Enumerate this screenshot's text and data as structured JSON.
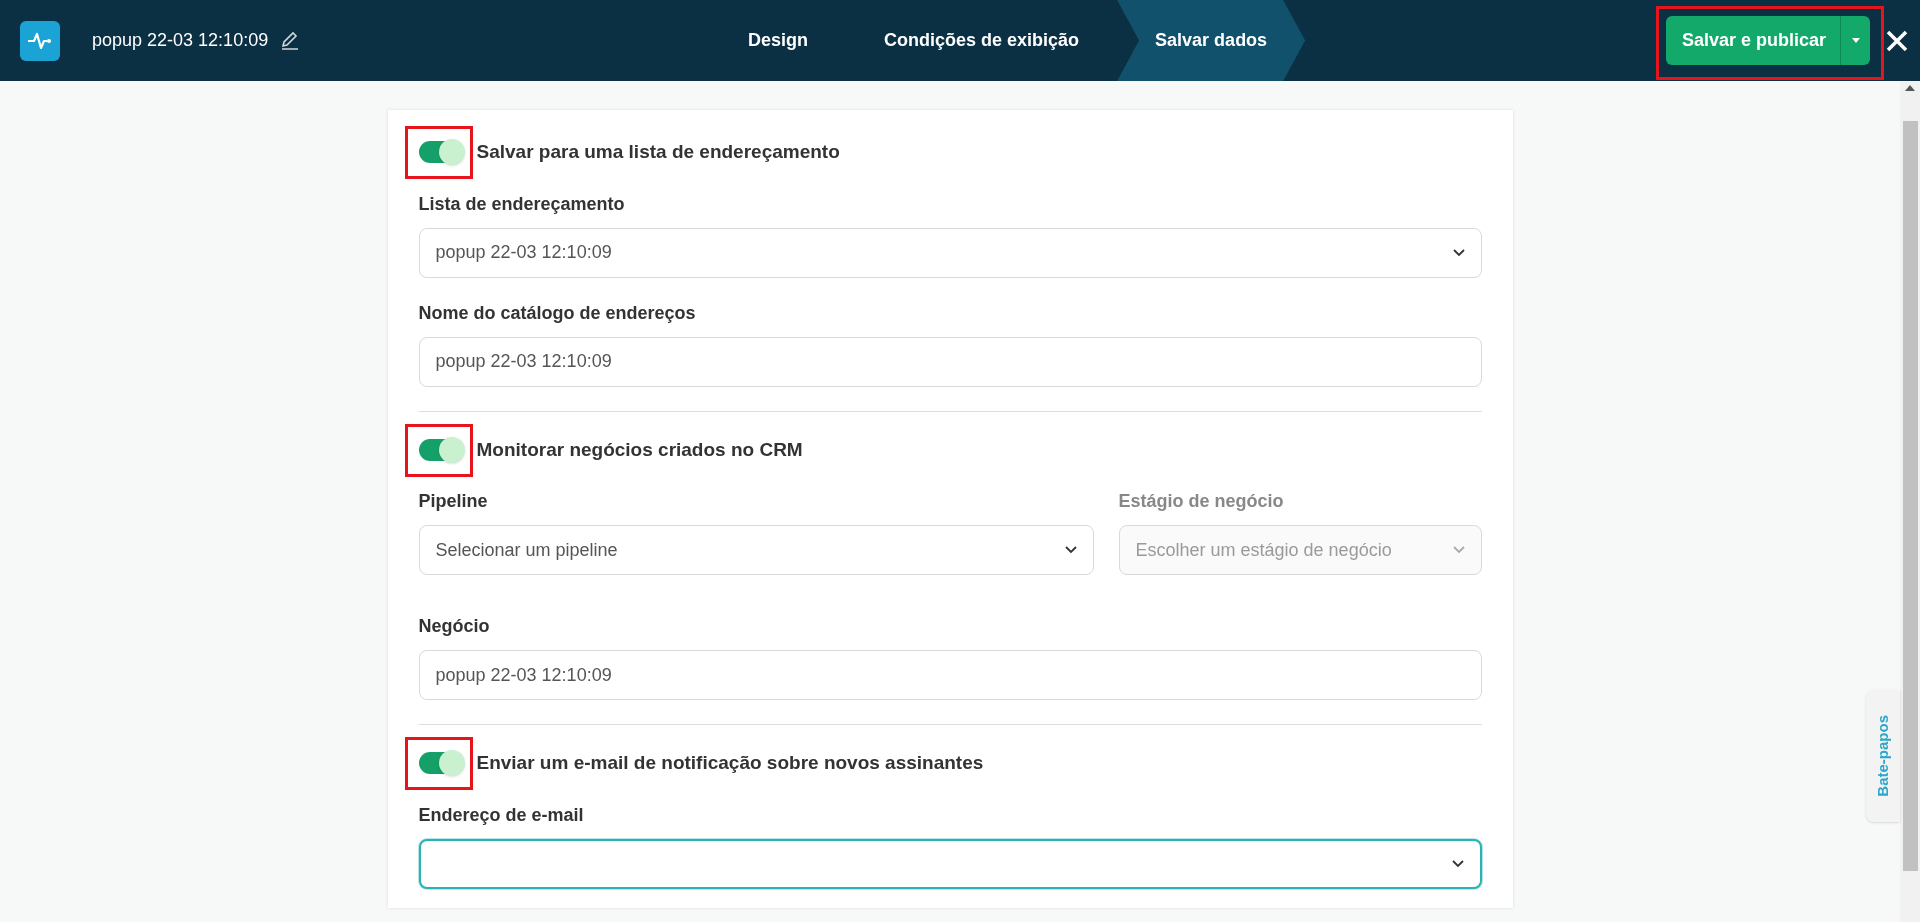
{
  "header": {
    "title": "popup 22-03 12:10:09",
    "steps": [
      {
        "label": "Design",
        "selected": false
      },
      {
        "label": "Condições de exibição",
        "selected": false
      },
      {
        "label": "Salvar dados",
        "selected": true
      }
    ],
    "save_button": {
      "label": "Salvar e publicar",
      "highlighted": true
    }
  },
  "sections": [
    {
      "toggle": {
        "label": "Salvar para uma lista de endereçamento",
        "on": true,
        "highlighted": true
      },
      "rows": [
        [
          {
            "kind": "select",
            "label": "Lista de endereçamento",
            "value": "popup 22-03 12:10:09",
            "disabled": false,
            "focused": false
          }
        ],
        [
          {
            "kind": "input",
            "label": "Nome do catálogo de endereços",
            "value": "popup 22-03 12:10:09",
            "disabled": false,
            "focused": false
          }
        ]
      ]
    },
    {
      "toggle": {
        "label": "Monitorar negócios criados no CRM",
        "on": true,
        "highlighted": true
      },
      "rows": [
        [
          {
            "kind": "select",
            "label": "Pipeline",
            "value": "Selecionar um pipeline",
            "disabled": false,
            "focused": false
          },
          {
            "kind": "select",
            "label": "Estágio de negócio",
            "placeholder": "Escolher um estágio de negócio",
            "disabled": true,
            "focused": false
          }
        ],
        [
          {
            "kind": "input",
            "label": "Negócio",
            "value": "popup 22-03 12:10:09",
            "disabled": false,
            "focused": false
          }
        ]
      ]
    },
    {
      "toggle": {
        "label": "Enviar um e-mail de notificação sobre novos assinantes",
        "on": true,
        "highlighted": true
      },
      "rows": [
        [
          {
            "kind": "select",
            "label": "Endereço de e-mail",
            "disabled": false,
            "focused": true
          }
        ]
      ]
    }
  ],
  "chat_tab": "Bate-papos"
}
